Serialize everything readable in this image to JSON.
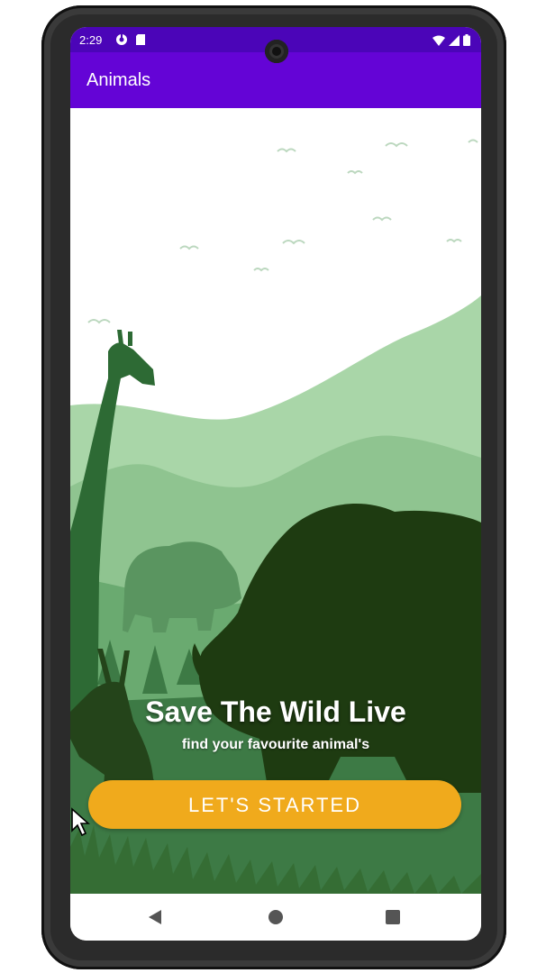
{
  "status_bar": {
    "time": "2:29",
    "left_icons": [
      "sync-icon",
      "sd-card-icon"
    ],
    "right_icons": [
      "wifi-icon",
      "signal-icon",
      "battery-icon"
    ],
    "background": "#4b05b8"
  },
  "app_bar": {
    "title": "Animals",
    "background": "#6404d6"
  },
  "hero": {
    "headline": "Save The Wild Live",
    "subtitle": "find your favourite animal's",
    "illustration": "wildlife-silhouette-illustration"
  },
  "cta": {
    "label": "LET'S STARTED",
    "color": "#f0aa1c"
  },
  "nav_bar": {
    "icons": [
      "back-icon",
      "home-icon",
      "recents-icon"
    ]
  }
}
